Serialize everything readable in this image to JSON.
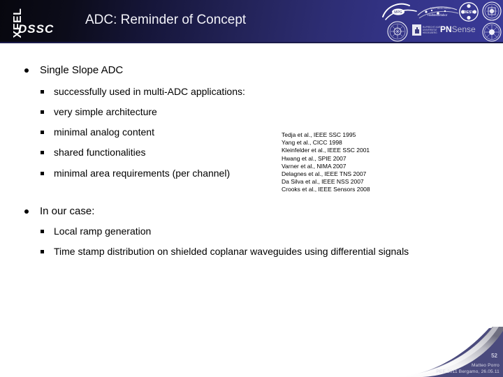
{
  "header": {
    "logo_xfel": "XFEL",
    "logo_dssc": "DSSC",
    "title": "ADC: Reminder of Concept",
    "partner_logos": [
      {
        "name": "mpi-logo",
        "caption": "MPG"
      },
      {
        "name": "mpi-halbleiterlabor-logo",
        "caption": "MPI Halbleiterlabor"
      },
      {
        "name": "desy-logo",
        "caption": "DESY"
      },
      {
        "name": "universita-pavia-seal",
        "caption": ""
      },
      {
        "name": "politecnico-milano-seal",
        "caption": ""
      },
      {
        "name": "universita-bergamo-seal",
        "caption": ""
      },
      {
        "name": "heidelberg-logo",
        "caption": "Ruprecht-Karls-Universitat Heidelberg"
      }
    ],
    "pnsense_prefix": "PN",
    "pnsense_suffix": "Sense"
  },
  "body": {
    "sections": [
      {
        "heading": "Single Slope ADC",
        "items": [
          "successfully used in multi-ADC applications:",
          "very simple architecture",
          "minimal analog content",
          "shared functionalities",
          "minimal area requirements (per channel)"
        ]
      },
      {
        "heading": "In our case:",
        "items": [
          "Local ramp generation",
          "Time stamp distribution on shielded coplanar waveguides using differential signals"
        ]
      }
    ],
    "references": [
      "Tedja et al., IEEE SSC 1995",
      "Yang et al., CICC 1998",
      "Kleinfelder et al., IEEE SSC 2001",
      "Hwang et al., SPIE 2007",
      "Varner et al., NIMA 2007",
      "Delagnes et al., IEEE TNS 2007",
      "Da Silva et al., IEEE NSS 2007",
      "Crooks et al., IEEE Sensors 2008"
    ]
  },
  "footer": {
    "author": "Matteo Porro",
    "event": "PEE 2011 Bergamo, 26.05.11",
    "slide_number": "52"
  },
  "colors": {
    "header_dark": "#07070e",
    "header_blue": "#3a3a97",
    "footer_blue": "#4a4a7d",
    "text_black": "#000000"
  }
}
